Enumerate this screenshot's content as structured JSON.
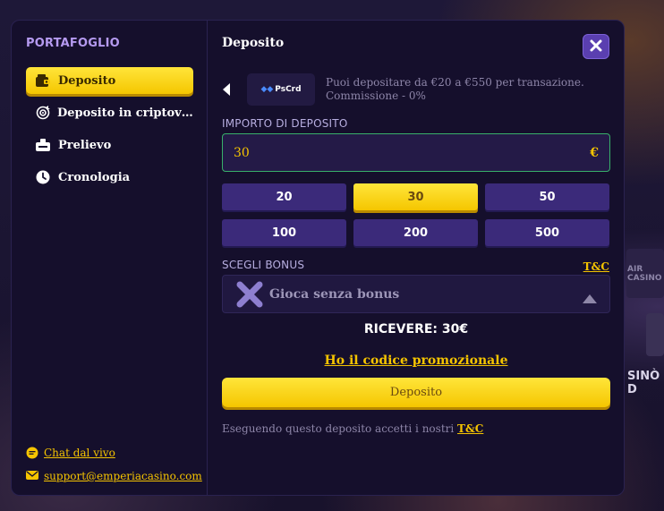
{
  "sidebar": {
    "title": "PORTAFOGLIO",
    "items": [
      {
        "label": "Deposito",
        "icon": "wallet-icon",
        "active": true
      },
      {
        "label": "Deposito in criptova...",
        "icon": "crypto-target-icon",
        "active": false
      },
      {
        "label": "Prelievo",
        "icon": "withdraw-icon",
        "active": false
      },
      {
        "label": "Cronologia",
        "icon": "clock-icon",
        "active": false
      }
    ],
    "support": {
      "chat_label": "Chat dal vivo",
      "email_label": "support@emperiacasino.com"
    }
  },
  "main": {
    "title": "Deposito",
    "payment": {
      "method_label": "PsCrd",
      "info_line1": "Puoi depositare da €20 a €550 per transazione.",
      "info_line2": "Commissione - 0%"
    },
    "amount": {
      "label": "IMPORTO DI DEPOSITO",
      "value": "30",
      "currency": "€"
    },
    "presets": [
      "20",
      "30",
      "50",
      "100",
      "200",
      "500"
    ],
    "selected_preset": "30",
    "bonus": {
      "label": "SCEGLI BONUS",
      "tc_label": "T&C",
      "selected": "Gioca senza bonus"
    },
    "receive_text": "RICEVERE: 30€",
    "promo_link": "Ho il codice promozionale",
    "submit_label": "Deposito",
    "terms_text": "Eseguendo questo deposito accetti i nostri",
    "terms_link": "T&C"
  },
  "background": {
    "partial_text_1": "AIR\nCASINO",
    "partial_text_2": "SINÒ D"
  },
  "colors": {
    "accent": "#f5c400",
    "panel": "#150f2c",
    "preset": "#3b2a7a",
    "field_border": "#38b06a"
  }
}
